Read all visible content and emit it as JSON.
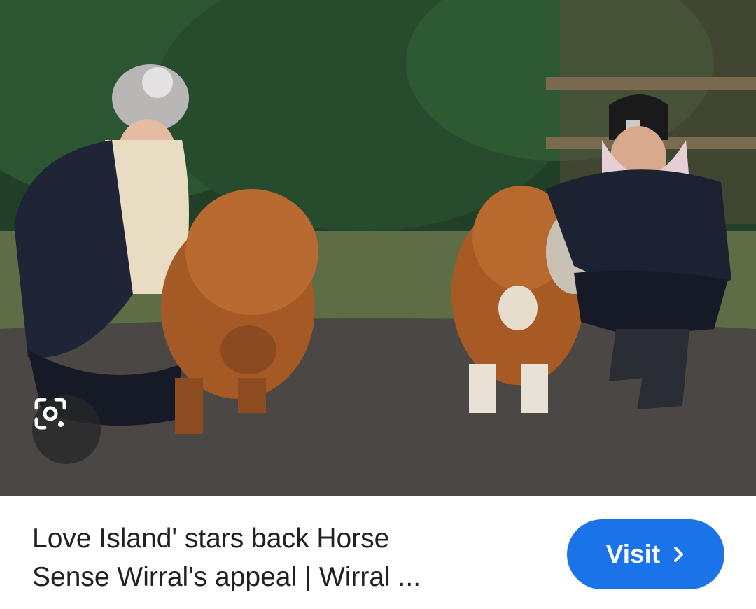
{
  "image": {
    "alt_subject": "photo",
    "lens_icon": "google-lens-icon"
  },
  "result": {
    "title_line1": "Love Island' stars back Horse",
    "title_line2": "Sense Wirral's appeal | Wirral ..."
  },
  "visit_button": {
    "label": "Visit",
    "icon": "chevron-right-icon",
    "color": "#1a73e8"
  }
}
